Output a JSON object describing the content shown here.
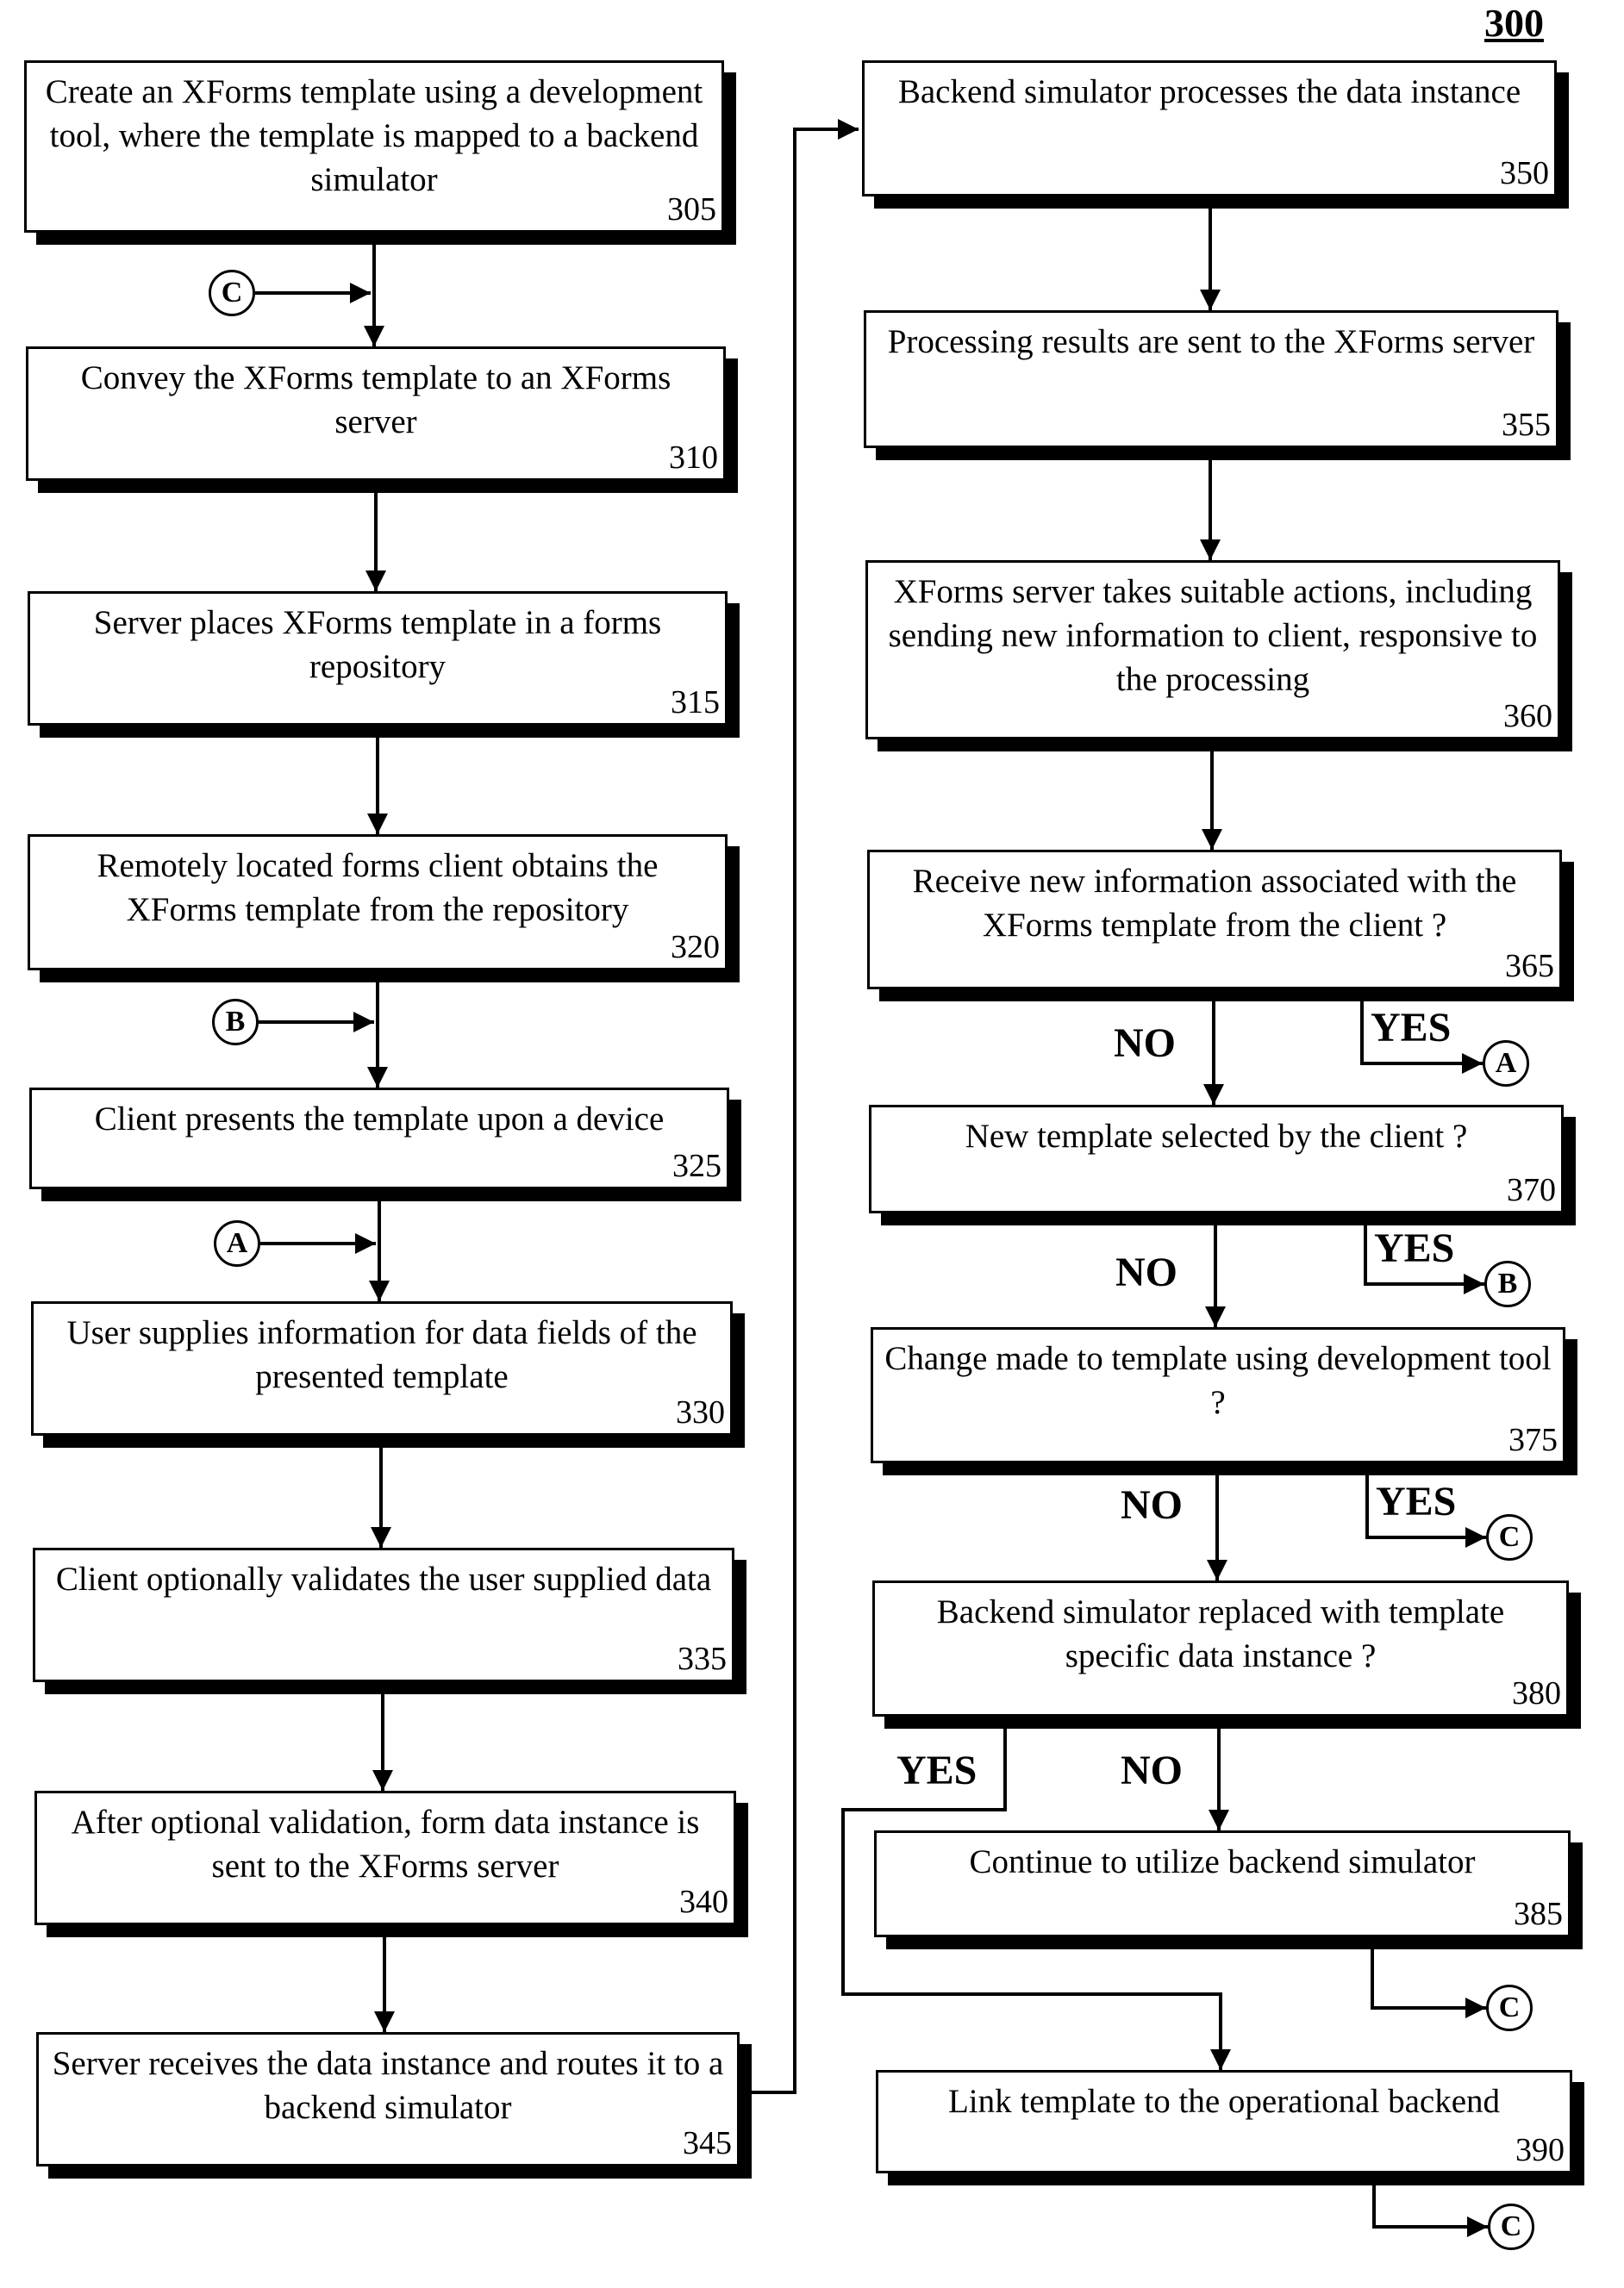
{
  "figure_number": "300",
  "steps": {
    "s305": {
      "text": "Create an XForms template using a development tool, where the template is mapped to a backend simulator",
      "num": "305"
    },
    "s310": {
      "text": "Convey the XForms template to an XForms server",
      "num": "310"
    },
    "s315": {
      "text": "Server places XForms template in a forms repository",
      "num": "315"
    },
    "s320": {
      "text": "Remotely located forms client obtains the XForms template from the repository",
      "num": "320"
    },
    "s325": {
      "text": "Client presents the template upon a device",
      "num": "325"
    },
    "s330": {
      "text": "User supplies information for data fields of the presented template",
      "num": "330"
    },
    "s335": {
      "text": "Client optionally validates the user supplied data",
      "num": "335"
    },
    "s340": {
      "text": "After optional validation, form data instance is sent to the XForms server",
      "num": "340"
    },
    "s345": {
      "text": "Server receives the data instance and routes it to a backend simulator",
      "num": "345"
    },
    "s350": {
      "text": "Backend simulator processes the data instance",
      "num": "350"
    },
    "s355": {
      "text": "Processing results are sent to the XForms server",
      "num": "355"
    },
    "s360": {
      "text": "XForms server takes suitable actions, including sending new information to client, responsive to the processing",
      "num": "360"
    },
    "s365": {
      "text": "Receive new information associated with the XForms template from the client ?",
      "num": "365"
    },
    "s370": {
      "text": "New template selected by the client ?",
      "num": "370"
    },
    "s375": {
      "text": "Change made to template using development tool ?",
      "num": "375"
    },
    "s380": {
      "text": "Backend simulator replaced with template specific data instance ?",
      "num": "380"
    },
    "s385": {
      "text": "Continue to utilize backend simulator",
      "num": "385"
    },
    "s390": {
      "text": "Link template to the operational backend",
      "num": "390"
    }
  },
  "labels": {
    "yes": "YES",
    "no": "NO"
  },
  "connectors": {
    "a": "A",
    "b": "B",
    "c": "C"
  }
}
